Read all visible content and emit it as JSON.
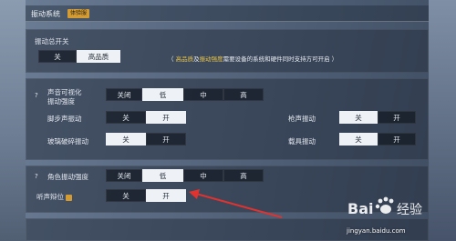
{
  "header": {
    "title": "振动系统",
    "badge": "体验服"
  },
  "master": {
    "label": "振动总开关",
    "options": [
      "关",
      "高品质"
    ],
    "selected": 1,
    "note_parts": [
      "（ ",
      "高品质",
      "及",
      "振动强度",
      "需要设备的系统和硬件同时支持方可开启 ）"
    ]
  },
  "sound_strength": {
    "help": "?",
    "label_line1": "声音可视化",
    "label_line2": "振动强度",
    "options": [
      "关闭",
      "低",
      "中",
      "高"
    ],
    "selected": 1
  },
  "footstep": {
    "label": "脚步声振动",
    "options": [
      "关",
      "开"
    ],
    "selected": 1
  },
  "gunshot": {
    "label": "枪声振动",
    "options": [
      "关",
      "开"
    ],
    "selected": 0
  },
  "glass": {
    "label": "玻璃破碎振动",
    "options": [
      "关",
      "开"
    ],
    "selected": 0
  },
  "vehicle": {
    "label": "载具振动",
    "options": [
      "关",
      "开"
    ],
    "selected": 0
  },
  "character_strength": {
    "help": "?",
    "label": "角色振动强度",
    "options": [
      "关闭",
      "低",
      "中",
      "高"
    ],
    "selected": 1
  },
  "listen_pos": {
    "label": "听声辩位",
    "options": [
      "关",
      "开"
    ],
    "selected": 1
  },
  "watermark": {
    "logo_text": "Bai 经验",
    "url": "jingyan.baidu.com"
  },
  "colors": {
    "accent": "#d39b33",
    "highlight": "#e7c34a",
    "arrow": "#e0322f",
    "selected_bg": "#eef1f5"
  }
}
